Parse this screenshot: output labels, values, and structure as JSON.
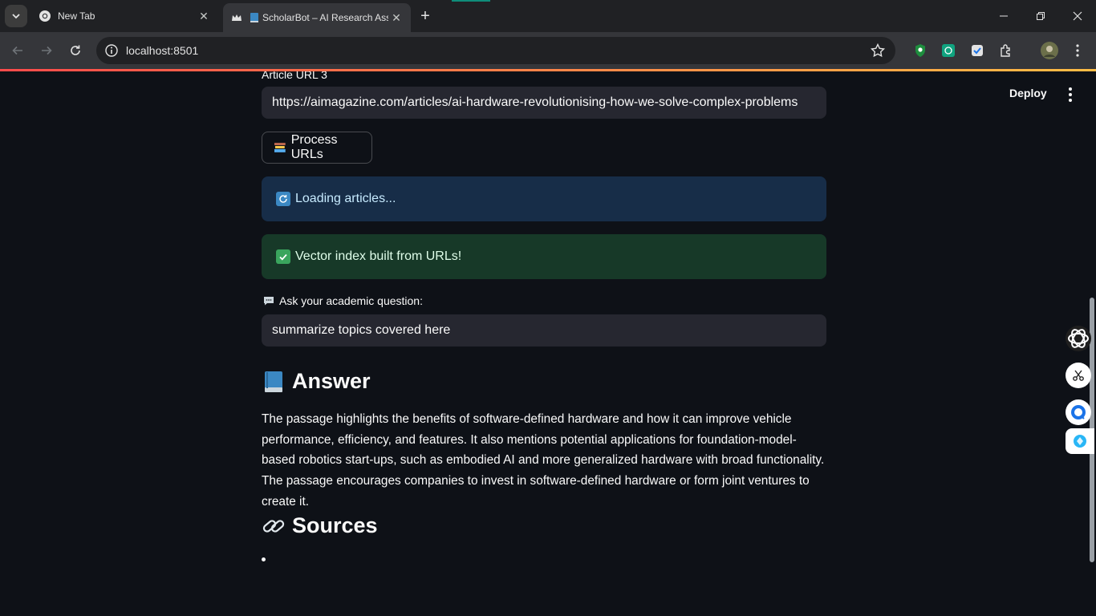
{
  "browser": {
    "tabs": [
      {
        "title": "New Tab",
        "favicon": "chrome-icon",
        "active": false
      },
      {
        "title": "ScholarBot – AI Research Ass",
        "favicon": "streamlit-crown-icon",
        "active": true
      }
    ],
    "address": "localhost:8501",
    "extensions": [
      "shield-extension-icon",
      "chatgpt-extension-icon",
      "checkbox-extension-icon",
      "puzzle-extensions-icon",
      "profile-avatar"
    ]
  },
  "header": {
    "deploy_label": "Deploy"
  },
  "form": {
    "url3_label": "Article URL 3",
    "url3_value": "https://aimagazine.com/articles/ai-hardware-revolutionising-how-we-solve-complex-problems",
    "process_label": "Process URLs",
    "info_text": "Loading articles...",
    "success_text": "Vector index built from URLs!",
    "question_label": "Ask your academic question:",
    "question_value": "summarize topics covered here"
  },
  "answer": {
    "heading": "Answer",
    "text": "The passage highlights the benefits of software-defined hardware and how it can improve vehicle performance, efficiency, and features. It also mentions potential applications for foundation-model-based robotics start-ups, such as embodied AI and more generalized hardware with broad functionality. The passage encourages companies to invest in software-defined hardware or form joint ventures to create it."
  },
  "sources": {
    "heading": "Sources"
  },
  "colors": {
    "page_bg": "#0e1117",
    "input_bg": "#262730",
    "info_bg": "#172d48",
    "success_bg": "#173928",
    "accent_red": "#ff4b4b"
  }
}
